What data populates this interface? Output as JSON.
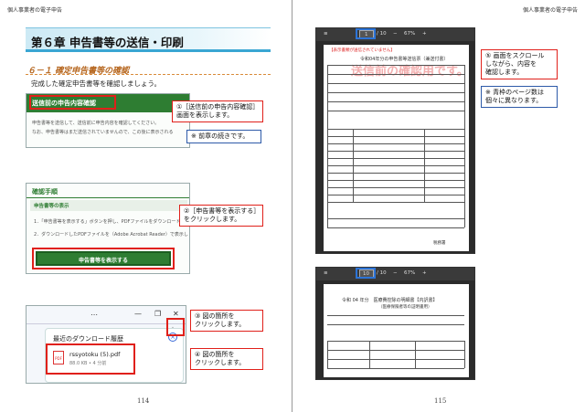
{
  "left_page": {
    "running_head": "個人事業者の電子申告",
    "chapter_title": "第６章 申告書等の送信・印刷",
    "section_title": "６－１ 確定申告書等の確認",
    "intro": "完成した確定申告書等を確認しましょう。",
    "page_number": "114",
    "shot1": {
      "header": "送信前の申告内容確認",
      "line1": "申告書等を送信して、送信前に申告内容を確認してください。",
      "line2": "なお、申告書等はまだ送信されていませんので、この後に表示される"
    },
    "shot2": {
      "title": "確認手順",
      "sub": "申告書等の表示",
      "step1": "1．「申告書等を表示する」ボタンを押し、PDFファイルをダウンロード",
      "step2": "2．ダウンロードしたPDFファイルを（Adobe Acrobat Reader）で表示し",
      "button": "申告書等を表示する"
    },
    "shot3": {
      "panel_title": "最近のダウンロード履歴",
      "file_name": "rssyotoku (5).pdf",
      "file_size": "88.0 KB • 4 分前",
      "pdf_label": "PDF"
    },
    "callouts": {
      "c1": [
        "①［送信前の申告内容確認］",
        "画面を表示します。"
      ],
      "c1_note": "※ 前章の続きです。",
      "c2": [
        "②［申告書等を表示する］",
        "をクリックします。"
      ],
      "c3": [
        "③ 図の箇所を",
        "クリックします。"
      ],
      "c4": [
        "④ 図の箇所を",
        "クリックします。"
      ]
    }
  },
  "right_page": {
    "running_head": "個人事業者の電子申告",
    "page_number": "115",
    "viewer1": {
      "page_box": "1",
      "page_total": "/ 10",
      "zoom": "67%",
      "minus": "−",
      "plus": "+"
    },
    "viewer2": {
      "page_box": "10",
      "page_total": "/ 10",
      "zoom": "67%",
      "minus": "−",
      "plus": "+"
    },
    "doc1": {
      "red_note": "【表示書類が送信されていません】",
      "title": "令和04年分の申告書等送信票（兼送付書）",
      "watermark": "送信前の確認用です。",
      "seal_label": "税務署"
    },
    "doc2": {
      "title": "令和 04 年分　医療費控除の明細書【内訳書】",
      "sub": "（医療保険者等の証明書用）"
    },
    "callouts": {
      "c5": [
        "⑤ 画面をスクロール",
        "しながら、内容を",
        "確認します。"
      ],
      "c5_note": [
        "※ 青枠のページ数は",
        "個々に異なります。"
      ]
    }
  }
}
